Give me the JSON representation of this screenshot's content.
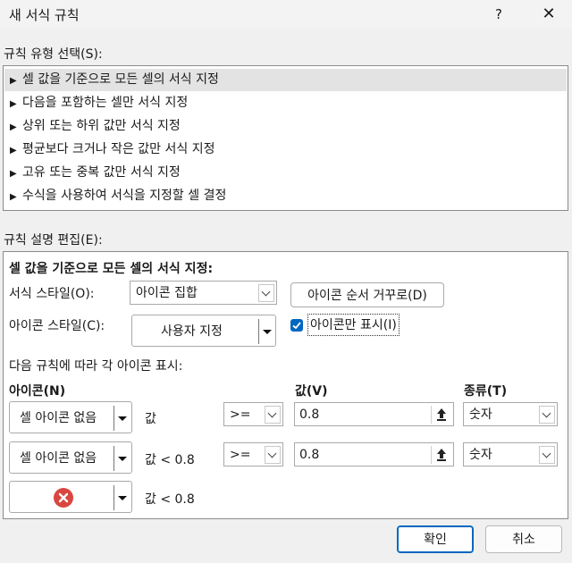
{
  "window": {
    "title": "새 서식 규칙",
    "help": "?",
    "close": "✕"
  },
  "rule_type": {
    "label": "규칙 유형 선택(S):",
    "items": [
      "셀 값을 기준으로 모든 셀의 서식 지정",
      "다음을 포함하는 셀만 서식 지정",
      "상위 또는 하위 값만 서식 지정",
      "평균보다 크거나 작은 값만 서식 지정",
      "고유 또는 중복 값만 서식 지정",
      "수식을 사용하여 서식을 지정할 셀 결정"
    ],
    "selected_index": 0
  },
  "edit": {
    "label": "규칙 설명 편집(E):",
    "heading": "셀 값을 기준으로 모든 셀의 서식 지정:",
    "format_style_label": "서식 스타일(O):",
    "format_style_value": "아이콘 집합",
    "reverse_order_button": "아이콘 순서 거꾸로(D)",
    "icon_style_label": "아이콘 스타일(C):",
    "icon_style_value": "사용자 지정",
    "show_icon_only_label": "아이콘만 표시(I)",
    "show_icon_only_checked": true,
    "rules_intro": "다음 규칙에 따라 각 아이콘 표시:",
    "col_icon": "아이콘(N)",
    "col_value": "값(V)",
    "col_type": "종류(T)",
    "rows": [
      {
        "icon": "셀 아이콘 없음",
        "condition_text": "값",
        "operator": ">=",
        "value": "0.8",
        "type": "숫자"
      },
      {
        "icon": "셀 아이콘 없음",
        "condition_text": "값 < 0.8",
        "operator": ">=",
        "value": "0.8",
        "type": "숫자"
      },
      {
        "icon": "",
        "icon_symbol": "red-x-circle-icon",
        "condition_text": "값 < 0.8"
      }
    ],
    "colors": {
      "accent": "#0067c0",
      "red_icon": "#d94640"
    }
  },
  "footer": {
    "ok": "확인",
    "cancel": "취소"
  }
}
